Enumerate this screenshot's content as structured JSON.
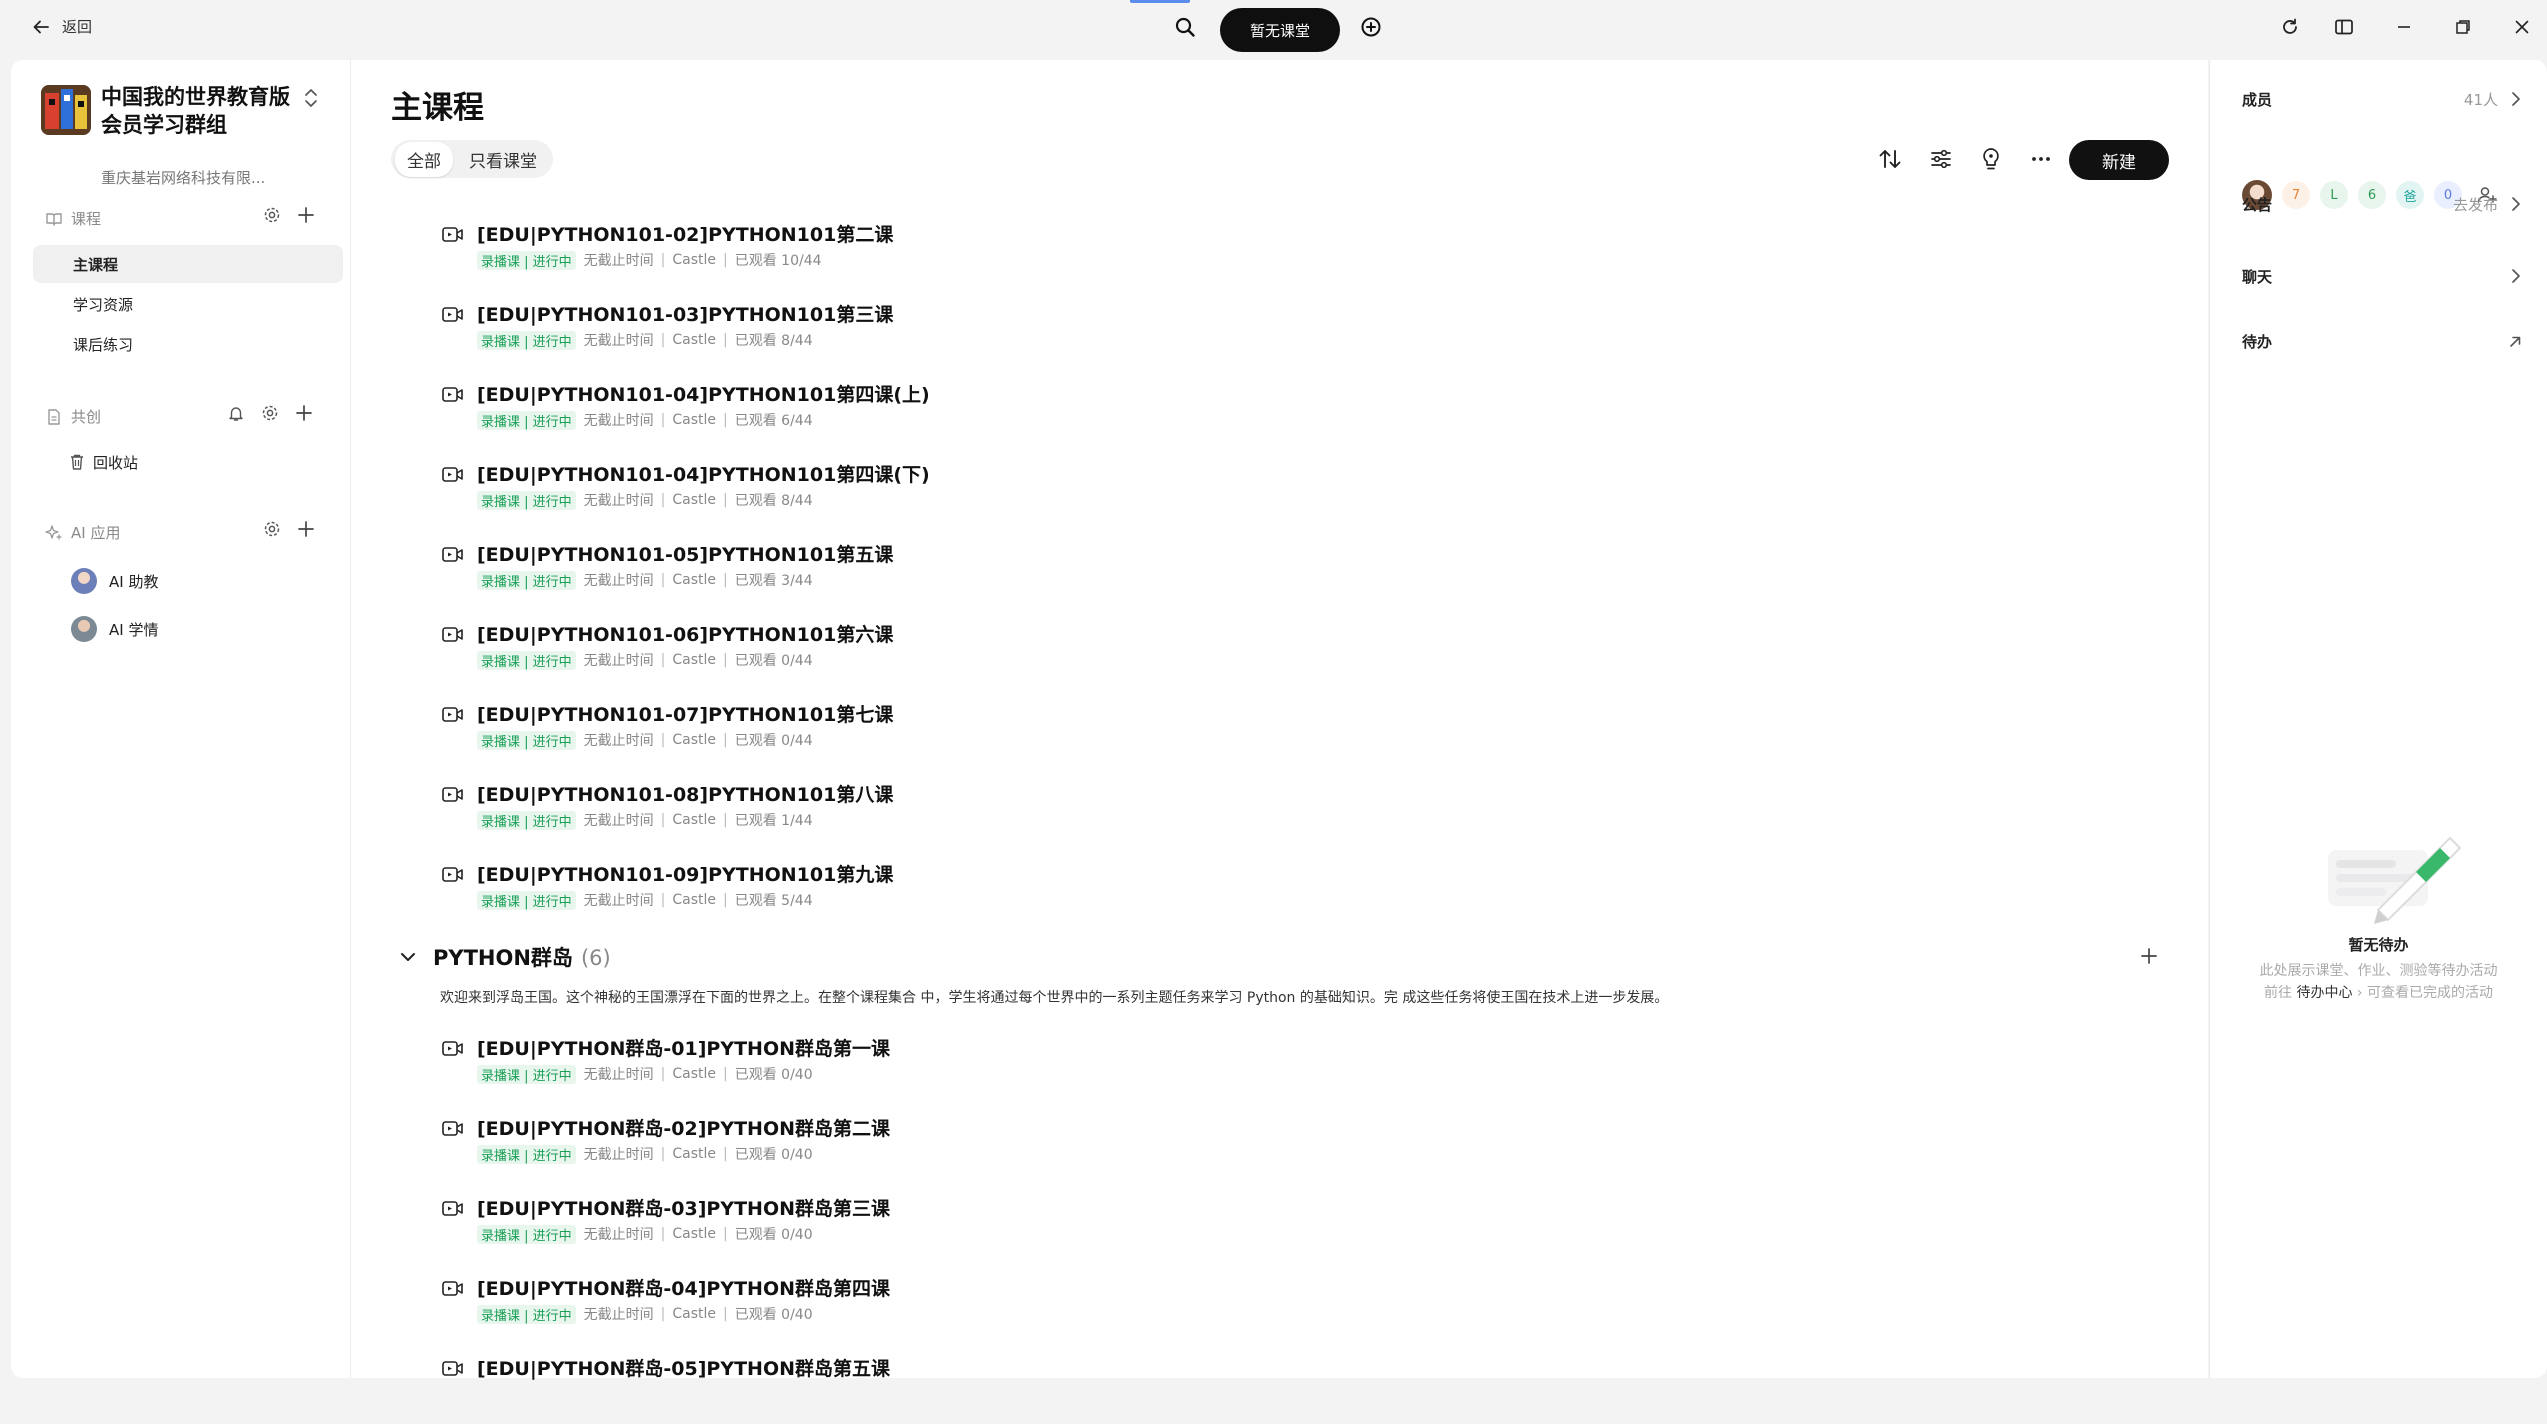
{
  "topbar": {
    "back_label": "返回",
    "pill_label": "暂无课堂"
  },
  "group": {
    "name": "中国我的世界教育版会员学习群组",
    "org": "重庆基岩网络科技有限..."
  },
  "sidebar": {
    "courses_label": "课程",
    "items": [
      {
        "label": "主课程",
        "active": true
      },
      {
        "label": "学习资源",
        "active": false
      },
      {
        "label": "课后练习",
        "active": false
      }
    ],
    "shared_label": "共创",
    "recycle_label": "回收站",
    "ai_label": "AI 应用",
    "ai_items": [
      {
        "label": "AI 助教"
      },
      {
        "label": "AI 学情"
      }
    ]
  },
  "main": {
    "title": "主课程",
    "filters": [
      "全部",
      "只看课堂"
    ],
    "new_label": "新建",
    "meta_tag": "录播课 | 进行中",
    "meta_deadline": "无截止时间",
    "meta_teacher": "Castle",
    "courses": [
      {
        "title": "[EDU|PYTHON101-02]PYTHON101第二课",
        "watched": "已观看 10/44"
      },
      {
        "title": "[EDU|PYTHON101-03]PYTHON101第三课",
        "watched": "已观看 8/44"
      },
      {
        "title": "[EDU|PYTHON101-04]PYTHON101第四课(上)",
        "watched": "已观看 6/44"
      },
      {
        "title": "[EDU|PYTHON101-04]PYTHON101第四课(下)",
        "watched": "已观看 8/44"
      },
      {
        "title": "[EDU|PYTHON101-05]PYTHON101第五课",
        "watched": "已观看 3/44"
      },
      {
        "title": "[EDU|PYTHON101-06]PYTHON101第六课",
        "watched": "已观看 0/44"
      },
      {
        "title": "[EDU|PYTHON101-07]PYTHON101第七课",
        "watched": "已观看 0/44"
      },
      {
        "title": "[EDU|PYTHON101-08]PYTHON101第八课",
        "watched": "已观看 1/44"
      },
      {
        "title": "[EDU|PYTHON101-09]PYTHON101第九课",
        "watched": "已观看 5/44"
      }
    ],
    "chapter": {
      "title": "PYTHON群岛",
      "count": "(6)",
      "description": "欢迎来到浮岛王国。这个神秘的王国漂浮在下面的世界之上。在整个课程集合 中，学生将通过每个世界中的一系列主题任务来学习 Python 的基础知识。完 成这些任务将使王国在技术上进一步发展。"
    },
    "chapter_courses": [
      {
        "title": "[EDU|PYTHON群岛-01]PYTHON群岛第一课",
        "watched": "已观看 0/40"
      },
      {
        "title": "[EDU|PYTHON群岛-02]PYTHON群岛第二课",
        "watched": "已观看 0/40"
      },
      {
        "title": "[EDU|PYTHON群岛-03]PYTHON群岛第三课",
        "watched": "已观看 0/40"
      },
      {
        "title": "[EDU|PYTHON群岛-04]PYTHON群岛第四课",
        "watched": "已观看 0/40"
      },
      {
        "title": "[EDU|PYTHON群岛-05]PYTHON群岛第五课",
        "watched": ""
      }
    ]
  },
  "right": {
    "members_label": "成员",
    "members_count": "41人",
    "member_badges": [
      {
        "text": "7",
        "color": "#e8833a",
        "bg": "#fdf0e6"
      },
      {
        "text": "L",
        "color": "#2e9e54",
        "bg": "#e7f5ec"
      },
      {
        "text": "6",
        "color": "#2e9e54",
        "bg": "#e7f5ec"
      },
      {
        "text": "爸",
        "color": "#1fa39a",
        "bg": "#e2f5f3"
      },
      {
        "text": "0",
        "color": "#5b7be0",
        "bg": "#eaefff"
      }
    ],
    "notice_label": "公告",
    "notice_action": "去发布",
    "chat_label": "聊天",
    "todo_label": "待办",
    "todo_empty_title": "暂无待办",
    "todo_empty_line1": "此处展示课堂、作业、测验等待办活动",
    "todo_empty_prefix": "前往",
    "todo_empty_link": "待办中心",
    "todo_empty_suffix": "可查看已完成的活动"
  }
}
